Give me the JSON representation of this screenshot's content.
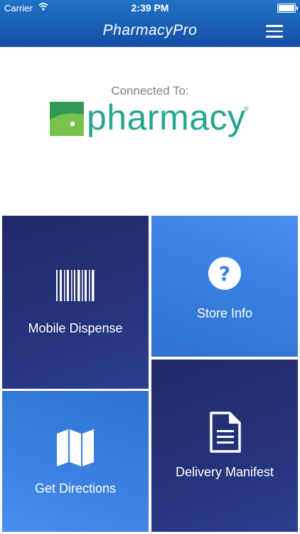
{
  "status_bar": {
    "carrier": "Carrier",
    "time": "2:39 PM"
  },
  "header": {
    "title": "PharmacyPro",
    "menu_icon": "hamburger-menu-icon"
  },
  "connection": {
    "label": "Connected To:",
    "pharmacy_name": "pharmacy",
    "trademark": "®"
  },
  "tiles": [
    {
      "label": "Mobile Dispense",
      "icon": "barcode-icon"
    },
    {
      "label": "Store Info",
      "icon": "question-circle-icon"
    },
    {
      "label": "Get Directions",
      "icon": "map-icon"
    },
    {
      "label": "Delivery Manifest",
      "icon": "document-icon"
    }
  ],
  "colors": {
    "header": "#1a5fb5",
    "tile_dark": "#232a6c",
    "tile_light": "#3f86ea",
    "logo_teal": "#27a58f",
    "logo_green": "#5fb84a"
  }
}
